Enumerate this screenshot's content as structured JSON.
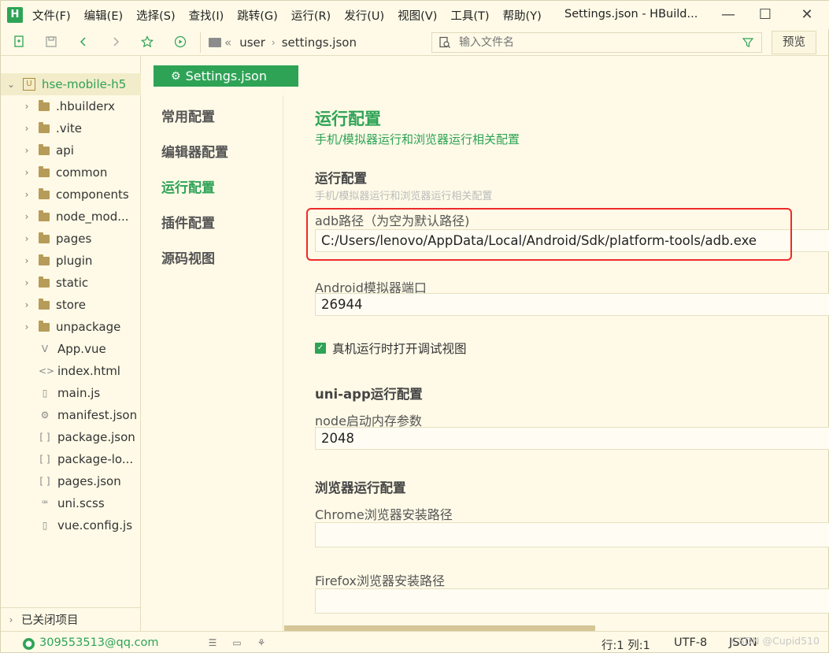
{
  "titlebar": {
    "logo": "H",
    "menu": [
      "文件(F)",
      "编辑(E)",
      "选择(S)",
      "查找(I)",
      "跳转(G)",
      "运行(R)",
      "发行(U)",
      "视图(V)",
      "工具(T)",
      "帮助(Y)"
    ],
    "window_title": "Settings.json - HBuild...",
    "minimize": "—",
    "maximize": "☐",
    "close": "✕"
  },
  "toolbar": {
    "breadcrumb_sep": "«",
    "path_user": "user",
    "path_sep": "›",
    "path_file": "settings.json",
    "search_placeholder": "输入文件名",
    "preview_label": "预览"
  },
  "sidebar": {
    "root": "hse-mobile-h5",
    "root_icon": "U",
    "folders": [
      ".hbuilderx",
      ".vite",
      "api",
      "common",
      "components",
      "node_mod...",
      "pages",
      "plugin",
      "static",
      "store",
      "unpackage"
    ],
    "files": [
      {
        "name": "App.vue",
        "icon": "V"
      },
      {
        "name": "index.html",
        "icon": "<>"
      },
      {
        "name": "main.js",
        "icon": "▯"
      },
      {
        "name": "manifest.json",
        "icon": "⚙"
      },
      {
        "name": "package.json",
        "icon": "[ ]"
      },
      {
        "name": "package-lo...",
        "icon": "[ ]"
      },
      {
        "name": "pages.json",
        "icon": "[ ]"
      },
      {
        "name": "uni.scss",
        "icon": "ꟹ"
      },
      {
        "name": "vue.config.js",
        "icon": "▯"
      }
    ],
    "closed_projects": "已关闭项目"
  },
  "tab": {
    "label": "Settings.json",
    "icon": "gear-icon"
  },
  "settings_nav": [
    "常用配置",
    "编辑器配置",
    "运行配置",
    "插件配置",
    "源码视图"
  ],
  "content": {
    "title": "运行配置",
    "subtitle": "手机/模拟器运行和浏览器运行相关配置",
    "section1_title": "运行配置",
    "section1_sub": "手机/模拟器运行和浏览器运行相关配置",
    "adb_label": "adb路径（为空为默认路径)",
    "adb_value": "C:/Users/lenovo/AppData/Local/Android/Sdk/platform-tools/adb.exe",
    "emulator_label": "Android模拟器端口",
    "emulator_value": "26944",
    "debug_checkbox": "真机运行时打开调试视图",
    "section2_title": "uni-app运行配置",
    "node_label": "node启动内存参数",
    "node_value": "2048",
    "section3_title": "浏览器运行配置",
    "chrome_label": "Chrome浏览器安装路径",
    "chrome_value": "",
    "firefox_label": "Firefox浏览器安装路径",
    "firefox_value": ""
  },
  "statusbar": {
    "user": "309553513@qq.com",
    "position": "行:1  列:1",
    "encoding": "UTF-8",
    "language": "JSON"
  },
  "watermark": "CSDN @Cupid510",
  "colors": {
    "accent": "#2ea356",
    "background": "#fefae7",
    "highlight": "#ee2a2a"
  }
}
